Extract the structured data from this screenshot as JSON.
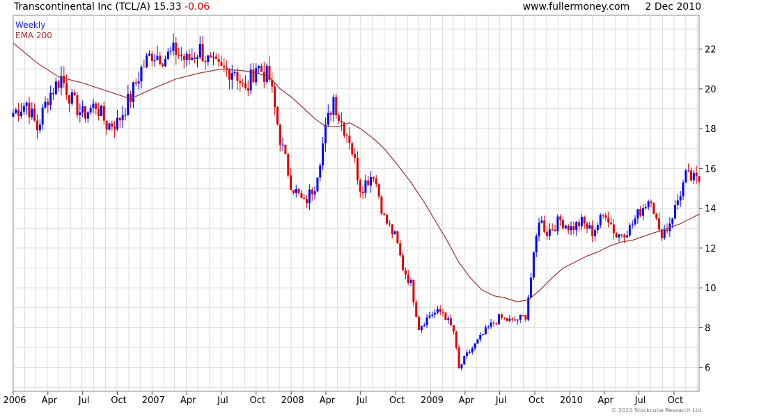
{
  "header": {
    "security": "Transcontinental Inc (TCL/A)",
    "last": "15.33",
    "change": "-0.06",
    "site": "www.fullermoney.com",
    "date": "2 Dec 2010"
  },
  "legend": {
    "weekly": "Weekly",
    "ema": "EMA 200"
  },
  "copyright": "© 2010 Stockcube Research Ltd",
  "colors": {
    "up": "#0000ff",
    "down": "#dd0000",
    "ema": "#993333",
    "grid": "#dcdcdc",
    "frame": "#888888"
  },
  "chart_data": {
    "type": "candlestick",
    "frequency": "weekly",
    "y_axis_side": "right",
    "ylim": [
      4.8,
      23.7
    ],
    "xlim": [
      "2006-01-02",
      "2010-12-06"
    ],
    "y_ticks": [
      6,
      8,
      10,
      12,
      14,
      16,
      18,
      20,
      22
    ],
    "x_ticks": [
      {
        "label": "2006",
        "date": "2006-01-02"
      },
      {
        "label": "Apr",
        "date": "2006-04-03"
      },
      {
        "label": "Jul",
        "date": "2006-07-03"
      },
      {
        "label": "Oct",
        "date": "2006-10-02"
      },
      {
        "label": "2007",
        "date": "2007-01-01"
      },
      {
        "label": "Apr",
        "date": "2007-04-02"
      },
      {
        "label": "Jul",
        "date": "2007-07-02"
      },
      {
        "label": "Oct",
        "date": "2007-10-01"
      },
      {
        "label": "2008",
        "date": "2008-01-01"
      },
      {
        "label": "Apr",
        "date": "2008-04-01"
      },
      {
        "label": "Jul",
        "date": "2008-07-01"
      },
      {
        "label": "Oct",
        "date": "2008-10-01"
      },
      {
        "label": "2009",
        "date": "2009-01-01"
      },
      {
        "label": "Apr",
        "date": "2009-04-01"
      },
      {
        "label": "Jul",
        "date": "2009-07-01"
      },
      {
        "label": "Oct",
        "date": "2009-10-01"
      },
      {
        "label": "2010",
        "date": "2010-01-01"
      },
      {
        "label": "Apr",
        "date": "2010-04-01"
      },
      {
        "label": "Jul",
        "date": "2010-07-01"
      },
      {
        "label": "Oct",
        "date": "2010-10-01"
      }
    ],
    "grid": true,
    "series": [
      {
        "name": "Weekly",
        "kind": "close",
        "anchors": [
          [
            "2006-01-02",
            18.8
          ],
          [
            "2006-02-06",
            19.3
          ],
          [
            "2006-03-06",
            18.0
          ],
          [
            "2006-04-03",
            19.6
          ],
          [
            "2006-05-08",
            20.6
          ],
          [
            "2006-06-05",
            19.4
          ],
          [
            "2006-07-03",
            18.7
          ],
          [
            "2006-08-07",
            19.2
          ],
          [
            "2006-09-04",
            18.2
          ],
          [
            "2006-10-02",
            18.3
          ],
          [
            "2006-11-06",
            19.6
          ],
          [
            "2006-12-04",
            21.0
          ],
          [
            "2007-01-01",
            21.8
          ],
          [
            "2007-02-05",
            21.6
          ],
          [
            "2007-03-05",
            21.9
          ],
          [
            "2007-04-02",
            21.4
          ],
          [
            "2007-05-07",
            22.0
          ],
          [
            "2007-06-04",
            21.2
          ],
          [
            "2007-07-02",
            20.9
          ],
          [
            "2007-08-06",
            21.0
          ],
          [
            "2007-09-03",
            19.8
          ],
          [
            "2007-10-01",
            21.2
          ],
          [
            "2007-11-05",
            20.5
          ],
          [
            "2007-12-03",
            17.5
          ],
          [
            "2008-01-01",
            15.2
          ],
          [
            "2008-02-04",
            14.2
          ],
          [
            "2008-03-03",
            15.2
          ],
          [
            "2008-04-01",
            18.0
          ],
          [
            "2008-04-21",
            19.6
          ],
          [
            "2008-05-05",
            18.6
          ],
          [
            "2008-06-02",
            17.5
          ],
          [
            "2008-07-01",
            15.0
          ],
          [
            "2008-08-04",
            15.8
          ],
          [
            "2008-09-01",
            13.5
          ],
          [
            "2008-10-01",
            12.5
          ],
          [
            "2008-10-20",
            11.0
          ],
          [
            "2008-11-10",
            10.2
          ],
          [
            "2008-12-01",
            8.0
          ],
          [
            "2009-01-01",
            8.7
          ],
          [
            "2009-02-02",
            8.8
          ],
          [
            "2009-03-02",
            7.8
          ],
          [
            "2009-03-16",
            5.9
          ],
          [
            "2009-04-01",
            6.5
          ],
          [
            "2009-05-04",
            7.3
          ],
          [
            "2009-06-01",
            8.0
          ],
          [
            "2009-07-01",
            8.5
          ],
          [
            "2009-08-03",
            8.3
          ],
          [
            "2009-09-07",
            8.6
          ],
          [
            "2009-09-28",
            11.5
          ],
          [
            "2009-10-12",
            13.5
          ],
          [
            "2009-11-02",
            12.8
          ],
          [
            "2009-12-07",
            13.4
          ],
          [
            "2010-01-04",
            13.0
          ],
          [
            "2010-02-01",
            13.3
          ],
          [
            "2010-03-01",
            12.8
          ],
          [
            "2010-04-05",
            13.8
          ],
          [
            "2010-05-03",
            12.6
          ],
          [
            "2010-06-07",
            13.0
          ],
          [
            "2010-07-05",
            13.9
          ],
          [
            "2010-08-02",
            14.6
          ],
          [
            "2010-08-23",
            12.7
          ],
          [
            "2010-09-13",
            13.0
          ],
          [
            "2010-10-04",
            14.0
          ],
          [
            "2010-11-01",
            15.6
          ],
          [
            "2010-12-06",
            15.33
          ]
        ]
      },
      {
        "name": "EMA 200",
        "kind": "line",
        "points": [
          [
            "2006-01-02",
            22.3
          ],
          [
            "2006-03-06",
            21.3
          ],
          [
            "2006-05-01",
            20.6
          ],
          [
            "2006-07-03",
            20.3
          ],
          [
            "2006-09-04",
            19.9
          ],
          [
            "2006-11-06",
            19.5
          ],
          [
            "2007-01-01",
            20.0
          ],
          [
            "2007-03-05",
            20.5
          ],
          [
            "2007-05-07",
            20.8
          ],
          [
            "2007-07-02",
            21.0
          ],
          [
            "2007-09-03",
            20.9
          ],
          [
            "2007-10-01",
            20.8
          ],
          [
            "2007-11-05",
            20.6
          ],
          [
            "2007-12-03",
            20.0
          ],
          [
            "2008-01-01",
            19.6
          ],
          [
            "2008-02-04",
            19.0
          ],
          [
            "2008-03-03",
            18.5
          ],
          [
            "2008-04-01",
            18.1
          ],
          [
            "2008-05-05",
            18.1
          ],
          [
            "2008-06-02",
            18.3
          ],
          [
            "2008-07-01",
            18.0
          ],
          [
            "2008-08-04",
            17.5
          ],
          [
            "2008-09-01",
            17.0
          ],
          [
            "2008-10-01",
            16.3
          ],
          [
            "2008-11-10",
            15.3
          ],
          [
            "2008-12-15",
            14.3
          ],
          [
            "2009-01-15",
            13.3
          ],
          [
            "2009-02-15",
            12.3
          ],
          [
            "2009-03-15",
            11.3
          ],
          [
            "2009-04-15",
            10.5
          ],
          [
            "2009-05-15",
            9.9
          ],
          [
            "2009-06-15",
            9.6
          ],
          [
            "2009-07-15",
            9.5
          ],
          [
            "2009-08-15",
            9.3
          ],
          [
            "2009-09-15",
            9.4
          ],
          [
            "2009-10-15",
            9.9
          ],
          [
            "2009-11-15",
            10.5
          ],
          [
            "2009-12-15",
            11.0
          ],
          [
            "2010-01-15",
            11.3
          ],
          [
            "2010-02-15",
            11.6
          ],
          [
            "2010-03-15",
            11.8
          ],
          [
            "2010-04-15",
            12.1
          ],
          [
            "2010-05-15",
            12.3
          ],
          [
            "2010-06-15",
            12.4
          ],
          [
            "2010-07-15",
            12.6
          ],
          [
            "2010-08-15",
            12.8
          ],
          [
            "2010-09-15",
            13.0
          ],
          [
            "2010-10-15",
            13.2
          ],
          [
            "2010-11-15",
            13.5
          ],
          [
            "2010-12-06",
            13.7
          ]
        ]
      }
    ]
  }
}
